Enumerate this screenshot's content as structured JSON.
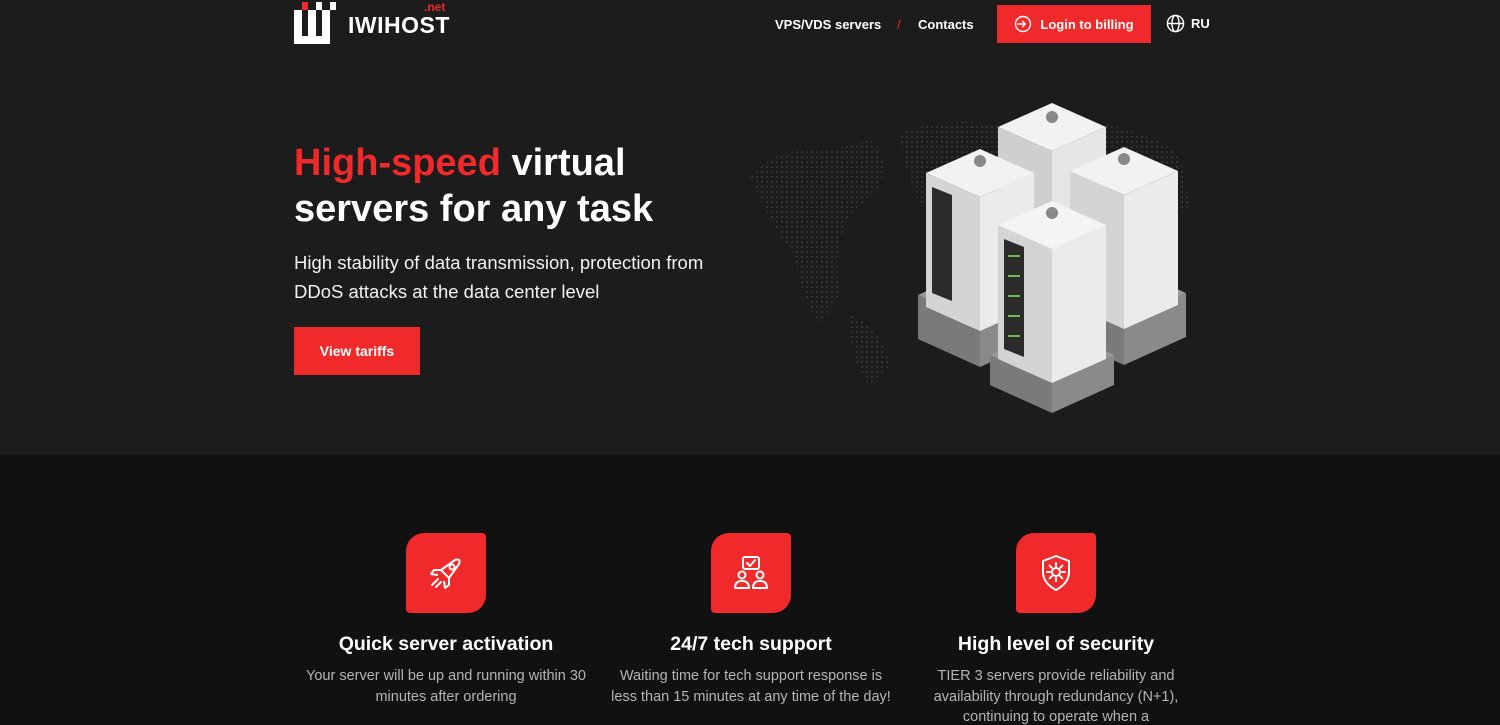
{
  "header": {
    "logo_text": "IWIHOST",
    "logo_suffix": ".net",
    "nav": {
      "vps": "VPS/VDS servers",
      "separator": "/",
      "contacts": "Contacts"
    },
    "login_label": "Login to billing",
    "login_icon": "login-icon",
    "lang_icon": "globe-icon",
    "lang_label": "RU"
  },
  "hero": {
    "title_accent": "High-speed",
    "title_rest": " virtual servers for any task",
    "subtitle": "High stability of data transmission, protection from DDoS attacks at the data center level",
    "cta_label": "View tariffs",
    "illustration": "isometric-server-racks-on-world-map"
  },
  "features": [
    {
      "icon": "rocket-icon",
      "title": "Quick server activation",
      "text": "Your server will be up and running within 30 minutes after ordering"
    },
    {
      "icon": "support-team-icon",
      "title": "24/7 tech support",
      "text": "Waiting time for tech support response is less than 15 minutes at any time of the day!"
    },
    {
      "icon": "shield-gear-icon",
      "title": "High level of security",
      "text": "TIER 3 servers provide reliability and availability through redundancy (N+1), continuing to operate when a"
    }
  ],
  "colors": {
    "accent": "#f0292a",
    "hero_bg": "#1c1c1c",
    "page_bg": "#111111"
  }
}
